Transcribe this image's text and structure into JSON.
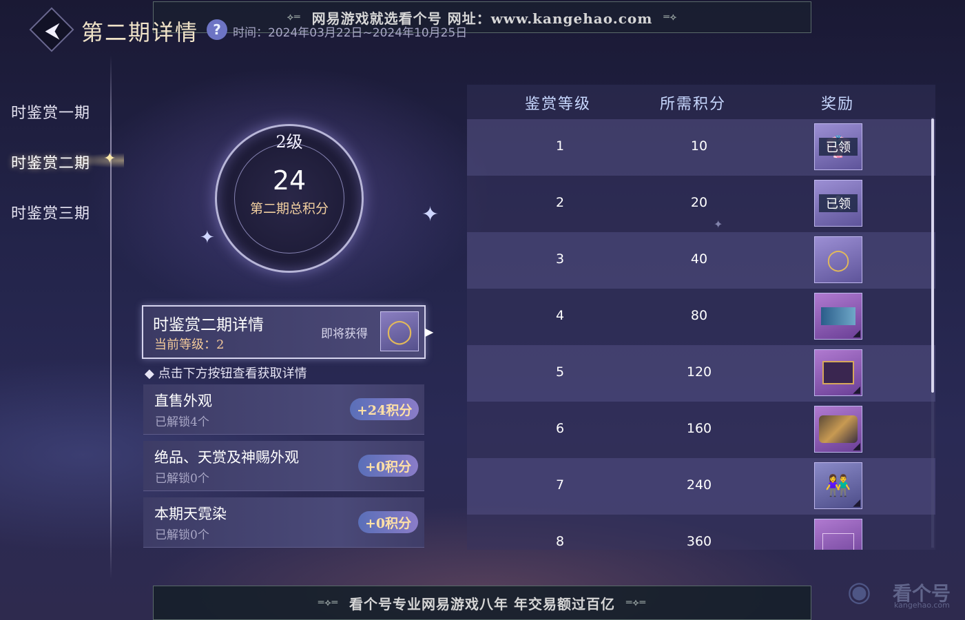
{
  "header": {
    "back_icon": "back-arrow-icon",
    "title": "第二期详情",
    "help_icon": "question-icon",
    "help_symbol": "?",
    "time_text": "时间：2024年03月22日~2024年10月25日"
  },
  "watermark": {
    "top_banner": "网易游戏就选看个号  网址：www.kangehao.com",
    "bottom_banner": "看个号专业网易游戏八年  年交易额过百亿",
    "logo_text": "看个号",
    "logo_url": "kangehao.com"
  },
  "nav": {
    "items": [
      {
        "label": "时鉴赏一期"
      },
      {
        "label": "时鉴赏二期"
      },
      {
        "label": "时鉴赏三期"
      }
    ],
    "active_index": 1
  },
  "score": {
    "level": "2级",
    "total": "24",
    "label": "第二期总积分"
  },
  "detail": {
    "title": "时鉴赏二期详情",
    "current_level": "当前等级：2",
    "upcoming_label": "即将获得",
    "upcoming_icon": "ring-icon"
  },
  "hint": "点击下方按钮查看获取详情",
  "categories": [
    {
      "title": "直售外观",
      "unlocked": "已解锁4个",
      "points": "+24积分"
    },
    {
      "title": "绝品、天赏及神赐外观",
      "unlocked": "已解锁0个",
      "points": "+0积分"
    },
    {
      "title": "本期天霓染",
      "unlocked": "已解锁0个",
      "points": "+0积分"
    }
  ],
  "table": {
    "headers": [
      "鉴赏等级",
      "所需积分",
      "奖励"
    ],
    "rows": [
      {
        "level": "1",
        "points": "10",
        "reward_icon": "outfit-icon",
        "status": "已领"
      },
      {
        "level": "2",
        "points": "20",
        "reward_icon": "accessory-icon",
        "status": "已领"
      },
      {
        "level": "3",
        "points": "40",
        "reward_icon": "ring-icon",
        "status": ""
      },
      {
        "level": "4",
        "points": "80",
        "reward_icon": "landscape-card-icon",
        "status": ""
      },
      {
        "level": "5",
        "points": "120",
        "reward_icon": "frame-icon",
        "status": ""
      },
      {
        "level": "6",
        "points": "160",
        "reward_icon": "mount-icon",
        "status": ""
      },
      {
        "level": "7",
        "points": "240",
        "reward_icon": "couple-portrait-icon",
        "status": ""
      },
      {
        "level": "8",
        "points": "360",
        "reward_icon": "card-icon",
        "status": ""
      }
    ]
  },
  "colors": {
    "accent_gold": "#f2c99a",
    "points_badge": "#8a7cc8",
    "header_blue": "#c8d8ff"
  }
}
